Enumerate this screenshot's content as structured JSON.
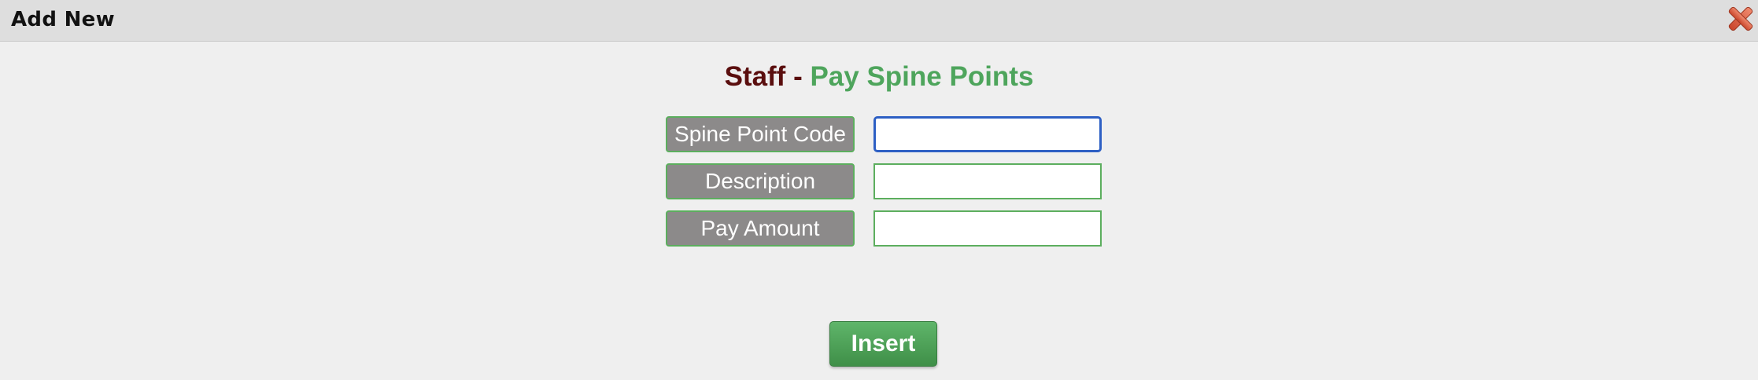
{
  "dialog": {
    "title": "Add New"
  },
  "heading": {
    "part1": "Staff",
    "separator": " - ",
    "part2": "Pay Spine Points"
  },
  "form": {
    "fields": [
      {
        "label": "Spine Point Code",
        "value": "",
        "focused": true
      },
      {
        "label": "Description",
        "value": ""
      },
      {
        "label": "Pay Amount",
        "value": ""
      }
    ]
  },
  "actions": {
    "insert_label": "Insert"
  },
  "colors": {
    "title_dark": "#5a0e0e",
    "title_green": "#4ea55c",
    "label_bg": "#8c8a8a",
    "field_border": "#5cae5e",
    "focus_border": "#2d5fc4",
    "button_green": "#4fa45a"
  },
  "icons": {
    "close": "close-x-icon"
  }
}
